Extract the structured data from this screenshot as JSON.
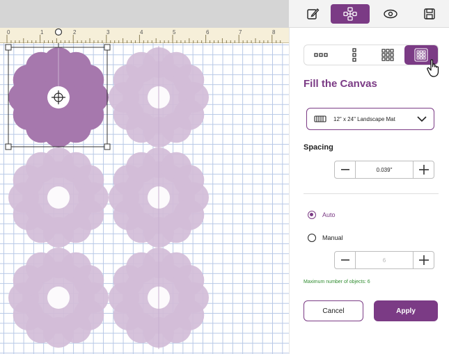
{
  "ruler": {
    "marks": [
      "0",
      "1",
      "2",
      "3",
      "4",
      "5",
      "6",
      "7",
      "8"
    ]
  },
  "toolbar": {
    "buttons": [
      {
        "icon": "edit-icon",
        "active": false
      },
      {
        "icon": "arrange-icon",
        "active": true
      },
      {
        "icon": "preview-eye-icon",
        "active": false
      },
      {
        "icon": "save-icon",
        "active": false
      }
    ]
  },
  "panel": {
    "layout_options": [
      {
        "icon": "layout-row-icon",
        "active": false
      },
      {
        "icon": "layout-column-icon",
        "active": false
      },
      {
        "icon": "layout-grid-icon",
        "active": false
      },
      {
        "icon": "layout-fill-icon",
        "active": true
      }
    ],
    "title": "Fill the Canvas",
    "mat": {
      "label": "12\" x 24\" Landscape Mat",
      "icon": "mat-icon"
    },
    "spacing": {
      "label": "Spacing",
      "value": "0.039\""
    },
    "mode": {
      "auto_label": "Auto",
      "manual_label": "Manual",
      "selected": "Auto"
    },
    "manual_count": {
      "value": "6"
    },
    "max_note": "Maximum number of objects: 6",
    "cancel_label": "Cancel",
    "apply_label": "Apply"
  },
  "colors": {
    "accent": "#7b3b85",
    "shape_selected": "#a678ad",
    "shape_copy": "#d2bdd8",
    "grid_line": "#b7c8e6",
    "ruler_bg": "#f6efd9",
    "note_green": "#2e8b2e"
  },
  "canvas": {
    "object_count": 6,
    "selected_index": 0
  }
}
